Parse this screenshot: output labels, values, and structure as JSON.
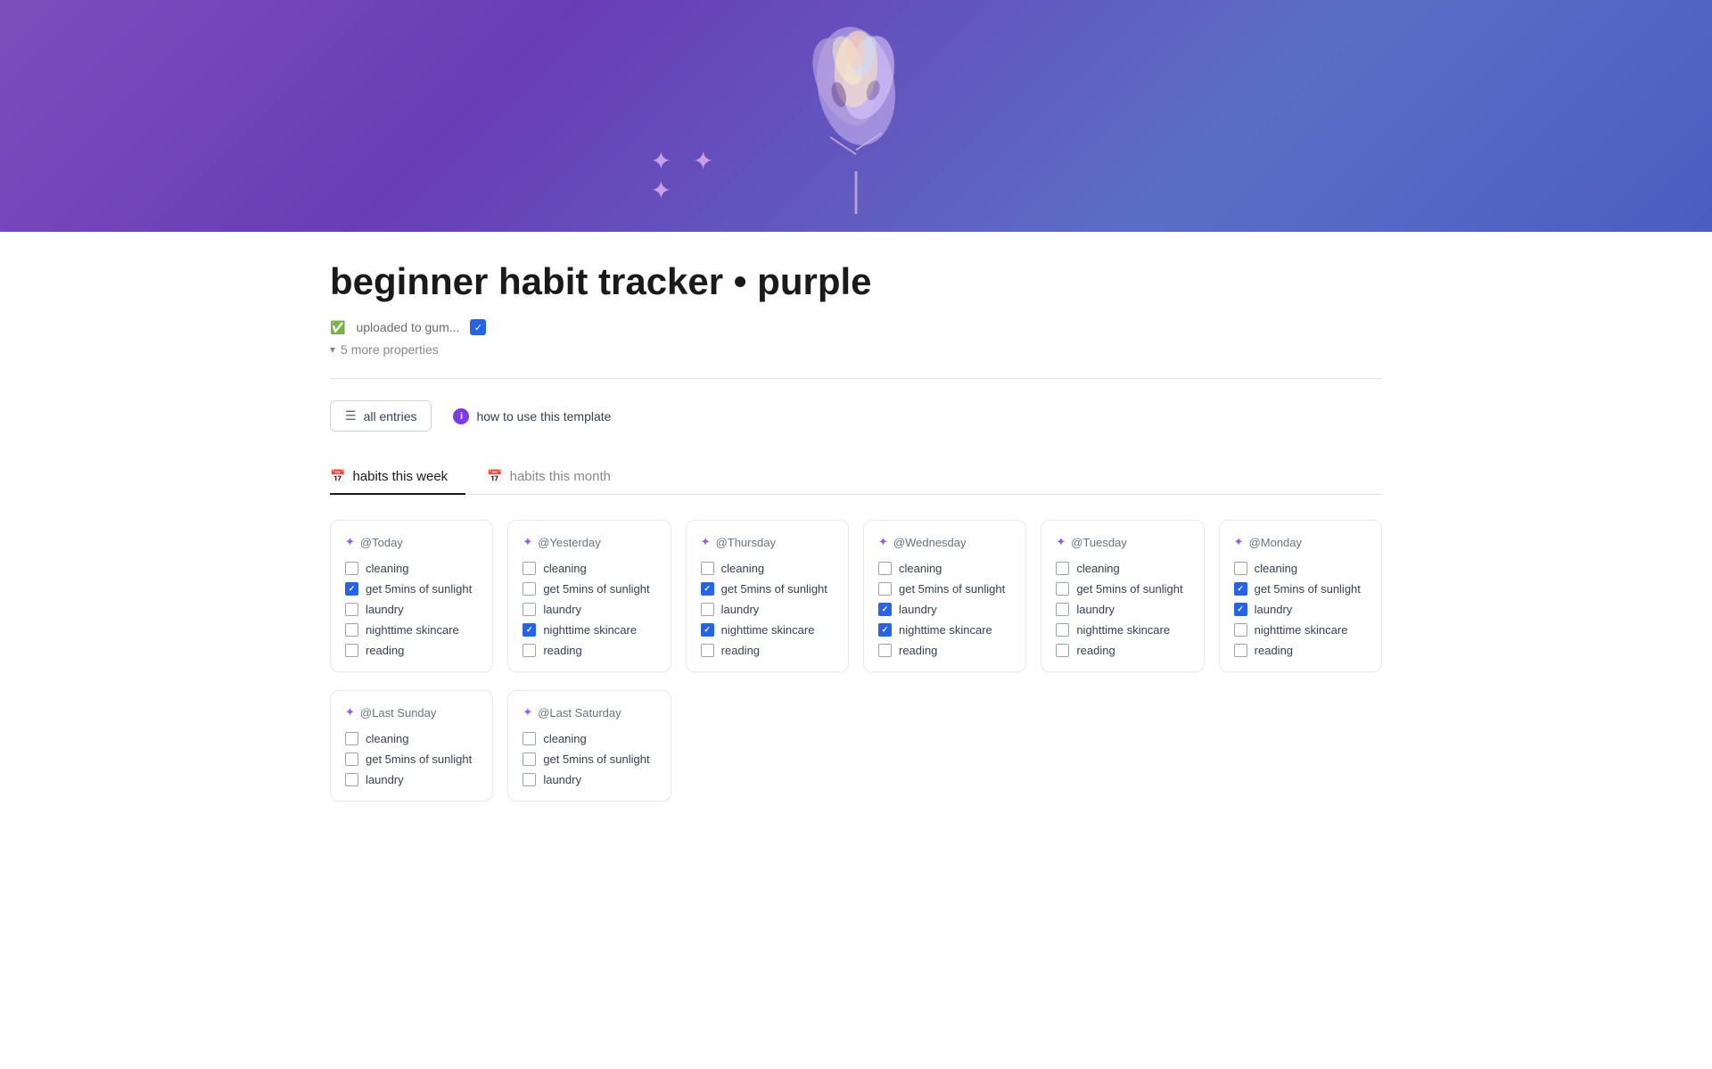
{
  "page": {
    "title": "beginner habit tracker • purple",
    "property_label": "uploaded to gum...",
    "more_properties_label": "5 more properties",
    "all_entries_label": "all entries",
    "how_to_label": "how to use this template"
  },
  "tabs": [
    {
      "id": "habits-week",
      "label": "habits this week",
      "icon": "📅",
      "active": true
    },
    {
      "id": "habits-month",
      "label": "habits this month",
      "icon": "📅",
      "active": false
    }
  ],
  "days_row1": [
    {
      "id": "today",
      "header": "@Today",
      "habits": [
        {
          "label": "cleaning",
          "checked": false
        },
        {
          "label": "get 5mins of sunlight",
          "checked": true
        },
        {
          "label": "laundry",
          "checked": false
        },
        {
          "label": "nighttime skincare",
          "checked": false
        },
        {
          "label": "reading",
          "checked": false
        }
      ]
    },
    {
      "id": "yesterday",
      "header": "@Yesterday",
      "habits": [
        {
          "label": "cleaning",
          "checked": false
        },
        {
          "label": "get 5mins of sunlight",
          "checked": false
        },
        {
          "label": "laundry",
          "checked": false
        },
        {
          "label": "nighttime skincare",
          "checked": true
        },
        {
          "label": "reading",
          "checked": false
        }
      ]
    },
    {
      "id": "thursday",
      "header": "@Thursday",
      "habits": [
        {
          "label": "cleaning",
          "checked": false
        },
        {
          "label": "get 5mins of sunlight",
          "checked": true
        },
        {
          "label": "laundry",
          "checked": false
        },
        {
          "label": "nighttime skincare",
          "checked": true
        },
        {
          "label": "reading",
          "checked": false
        }
      ]
    },
    {
      "id": "wednesday",
      "header": "@Wednesday",
      "habits": [
        {
          "label": "cleaning",
          "checked": false
        },
        {
          "label": "get 5mins of sunlight",
          "checked": false
        },
        {
          "label": "laundry",
          "checked": true
        },
        {
          "label": "nighttime skincare",
          "checked": true
        },
        {
          "label": "reading",
          "checked": false
        }
      ]
    },
    {
      "id": "tuesday",
      "header": "@Tuesday",
      "habits": [
        {
          "label": "cleaning",
          "checked": false
        },
        {
          "label": "get 5mins of sunlight",
          "checked": false
        },
        {
          "label": "laundry",
          "checked": false
        },
        {
          "label": "nighttime skincare",
          "checked": false
        },
        {
          "label": "reading",
          "checked": false
        }
      ]
    },
    {
      "id": "monday",
      "header": "@Monday",
      "habits": [
        {
          "label": "cleaning",
          "checked": false
        },
        {
          "label": "get 5mins of sunlight",
          "checked": true
        },
        {
          "label": "laundry",
          "checked": true
        },
        {
          "label": "nighttime skincare",
          "checked": false
        },
        {
          "label": "reading",
          "checked": false
        }
      ]
    }
  ],
  "days_row2": [
    {
      "id": "last-sunday",
      "header": "@Last Sunday",
      "habits": [
        {
          "label": "cleaning",
          "checked": false
        },
        {
          "label": "get 5mins of sunlight",
          "checked": false
        },
        {
          "label": "laundry",
          "checked": false
        }
      ]
    },
    {
      "id": "last-saturday",
      "header": "@Last Saturday",
      "habits": [
        {
          "label": "cleaning",
          "checked": false
        },
        {
          "label": "get 5mins of sunlight",
          "checked": false
        },
        {
          "label": "laundry",
          "checked": false
        }
      ]
    }
  ]
}
